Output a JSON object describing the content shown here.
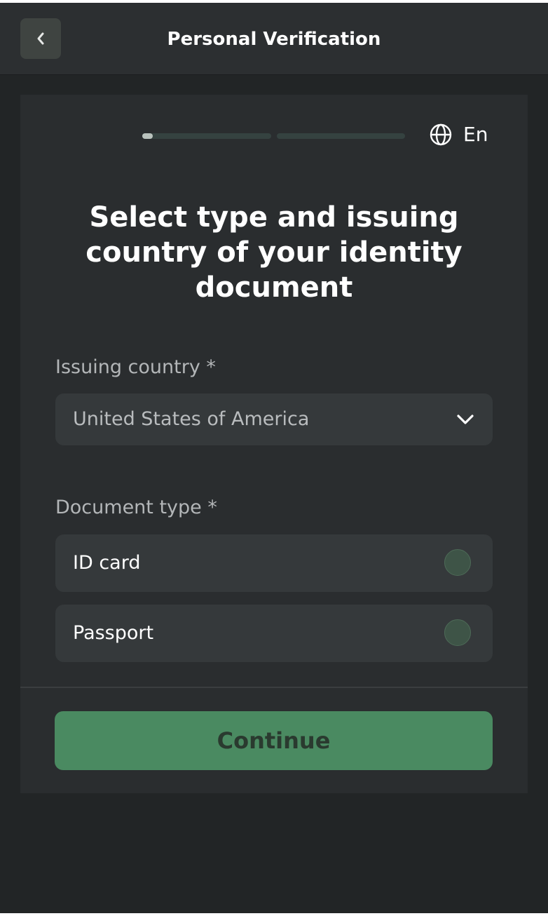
{
  "header": {
    "title": "Personal Verification",
    "back_icon": "chevron-left-icon"
  },
  "progress": {
    "steps": 2,
    "current_step": 1,
    "fill_fraction_step1": 0.08
  },
  "language": {
    "icon": "globe-icon",
    "label": "En"
  },
  "main": {
    "title": "Select type and issuing country of your identity document"
  },
  "country": {
    "label": "Issuing country *",
    "value": "United States of America",
    "chevron_icon": "chevron-down-icon"
  },
  "document_type": {
    "label": "Document type *",
    "options": [
      {
        "label": "ID card",
        "selected": false
      },
      {
        "label": "Passport",
        "selected": false
      }
    ]
  },
  "actions": {
    "continue_label": "Continue"
  },
  "colors": {
    "background": "#222526",
    "card": "#2a2d2f",
    "accent": "#4a8a61"
  }
}
